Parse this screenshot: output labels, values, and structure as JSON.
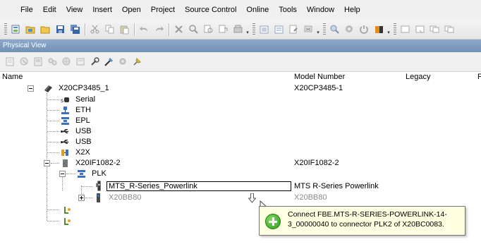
{
  "menu": [
    "File",
    "Edit",
    "View",
    "Insert",
    "Open",
    "Project",
    "Source Control",
    "Online",
    "Tools",
    "Window",
    "Help"
  ],
  "toolbar_icons": [
    "new-project-icon",
    "open-icon",
    "open-folder-icon",
    "save-icon",
    "save-all-icon",
    "cut-icon",
    "copy-icon",
    "paste-icon",
    "undo-icon",
    "redo-icon",
    "delete-icon",
    "find-icon",
    "find-replace-icon",
    "find-next-icon",
    "build-icon",
    "build-all-icon",
    "transfer-icon",
    "rebuild-icon",
    "online-monitor-icon",
    "settings-icon",
    "warning-icon",
    "stop-icon",
    "window-icon",
    "window-new-icon",
    "window-split-icon"
  ],
  "panel": {
    "title": "Physical View",
    "toolbar_icons": [
      "refresh-icon",
      "properties-icon",
      "configure-icon",
      "io-mapping-icon",
      "network-icon",
      "open-icon",
      "wrench-icon",
      "tool-icon",
      "plugin-icon",
      "pin-icon"
    ]
  },
  "columns": {
    "name": "Name",
    "model": "Model Number",
    "legacy": "Legacy",
    "fourth": "F"
  },
  "tree": {
    "root": {
      "label": "X20CP3485_1",
      "model": "X20CP3485-1"
    },
    "children": [
      {
        "label": "Serial",
        "icon": "serial-port-icon"
      },
      {
        "label": "ETH",
        "icon": "ethernet-icon"
      },
      {
        "label": "EPL",
        "icon": "powerlink-icon"
      },
      {
        "label": "USB",
        "icon": "usb-icon"
      },
      {
        "label": "USB",
        "icon": "usb-icon"
      },
      {
        "label": "X2X",
        "icon": "x2x-icon"
      }
    ],
    "if_module": {
      "label": "X20IF1082-2",
      "model": "X20IF1082-2"
    },
    "plk": {
      "label": "PLK"
    },
    "editing_node": {
      "value": "MTS_R-Series_Powerlink",
      "model": "MTS R-Series Powerlink"
    },
    "ghost_node": {
      "label": "X20BB80",
      "model": "X20BB80"
    }
  },
  "tooltip": {
    "text": "Connect FBE.MTS-R-SERIES-POWERLINK-14-3_00000040 to connector PLK2 of X20BC0083."
  },
  "colors": {
    "panel_title": "#7f9dc0",
    "tooltip_bg": "#ffffe1",
    "add_green": "#2f9b1c"
  }
}
